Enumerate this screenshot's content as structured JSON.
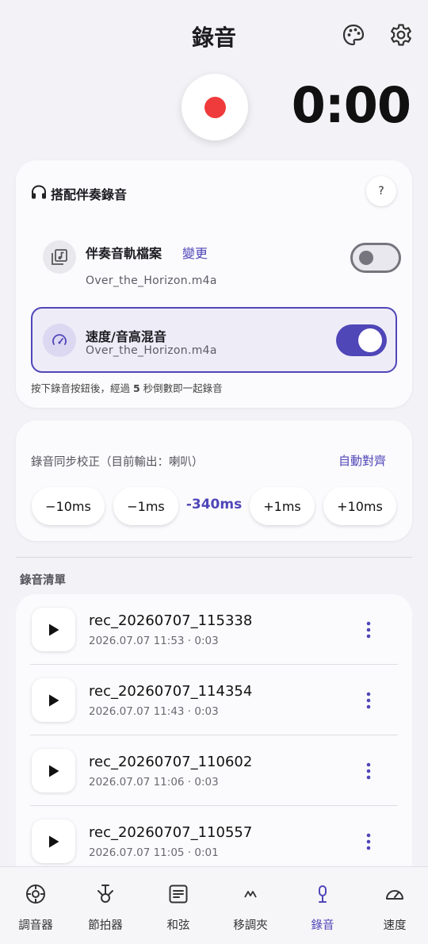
{
  "header": {
    "title": "錄音"
  },
  "timer": "0:00",
  "backing": {
    "title": "搭配伴奏錄音",
    "help_label": "?",
    "track_label": "伴奏音軌檔案",
    "change_label": "變更",
    "track_file": "Over_the_Horizon.m4a",
    "track_enabled": false,
    "speed_label": "速度/音高混音",
    "speed_file": "Over_the_Horizon.m4a",
    "speed_enabled": true,
    "hint_prefix": "按下錄音按鈕後，經過 ",
    "hint_seconds": "5",
    "hint_suffix": " 秒倒數即一起錄音"
  },
  "sync": {
    "label": "錄音同步校正（目前輸出：喇叭）",
    "auto_label": "自動對齊",
    "minus10": "−10ms",
    "minus1": "−1ms",
    "offset": "-340ms",
    "plus1": "+1ms",
    "plus10": "+10ms"
  },
  "list": {
    "title": "錄音清單",
    "items": [
      {
        "name": "rec_20260707_115338",
        "meta": "2026.07.07 11:53 · 0:03"
      },
      {
        "name": "rec_20260707_114354",
        "meta": "2026.07.07 11:43 · 0:03"
      },
      {
        "name": "rec_20260707_110602",
        "meta": "2026.07.07 11:06 · 0:03"
      },
      {
        "name": "rec_20260707_110557",
        "meta": "2026.07.07 11:05 · 0:01"
      }
    ]
  },
  "nav": {
    "items": [
      {
        "label": "調音器",
        "icon": "tuner-icon"
      },
      {
        "label": "節拍器",
        "icon": "metronome-icon"
      },
      {
        "label": "和弦",
        "icon": "chord-icon"
      },
      {
        "label": "移調夾",
        "icon": "capo-icon"
      },
      {
        "label": "錄音",
        "icon": "mic-icon"
      },
      {
        "label": "速度",
        "icon": "speed-icon"
      }
    ],
    "active_index": 4
  },
  "colors": {
    "accent": "#4f46b8",
    "record": "#ef3b3b",
    "background": "#f3f2f6"
  }
}
